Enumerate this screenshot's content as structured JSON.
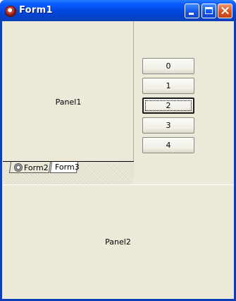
{
  "window": {
    "title": "Form1",
    "accent_color": "#0a5cff",
    "close_color": "#d9541c"
  },
  "panel1": {
    "label": "Panel1"
  },
  "tabs": [
    {
      "label": "Form2",
      "icon": "gear-icon",
      "active": false
    },
    {
      "label": "Form3",
      "active": true
    }
  ],
  "buttons": [
    {
      "label": "0"
    },
    {
      "label": "1"
    },
    {
      "label": "2",
      "focused": true
    },
    {
      "label": "3"
    },
    {
      "label": "4"
    }
  ],
  "panel2": {
    "label": "Panel2"
  }
}
